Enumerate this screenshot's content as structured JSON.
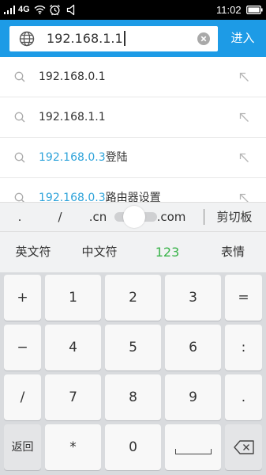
{
  "status_bar": {
    "network": "4G",
    "time": "11:02",
    "icons": [
      "signal-icon",
      "wifi-icon",
      "alarm-clock-icon",
      "ringer-icon",
      "battery-icon"
    ]
  },
  "address_bar": {
    "url": "192.168.1.1",
    "go_label": "进入",
    "icons": {
      "site": "globe-icon",
      "clear": "clear-icon"
    }
  },
  "suggestions": {
    "icons": {
      "leading": "search-icon",
      "trailing": "arrow-up-left-icon"
    },
    "items": [
      {
        "text": "192.168.0.1"
      },
      {
        "text": "192.168.1.1"
      },
      {
        "highlight": "192.168.0.3",
        "text": "登陆"
      },
      {
        "highlight": "192.168.0.3",
        "text": "路由器设置"
      }
    ]
  },
  "keyboard": {
    "toolbar": {
      "dot": ".",
      "slash": "/",
      "cn": ".cn",
      "com": ".com",
      "clipboard": "剪切板"
    },
    "modes": [
      "英文符",
      "中文符",
      "123",
      "表情"
    ],
    "active_mode_index": 2,
    "keys": [
      [
        "+",
        "1",
        "2",
        "3",
        "="
      ],
      [
        "−",
        "4",
        "5",
        "6",
        ":"
      ],
      [
        "/",
        "7",
        "8",
        "9",
        "."
      ],
      [
        "返回",
        "*",
        "0"
      ]
    ],
    "icons": {
      "space": "space-icon",
      "backspace": "backspace-icon",
      "toolbar_handle": "slider-knob"
    }
  },
  "colors": {
    "status_bar": "#000000",
    "accent": "#1d9be6",
    "highlight": "#2ea3da",
    "active_mode": "#3ab34a"
  }
}
